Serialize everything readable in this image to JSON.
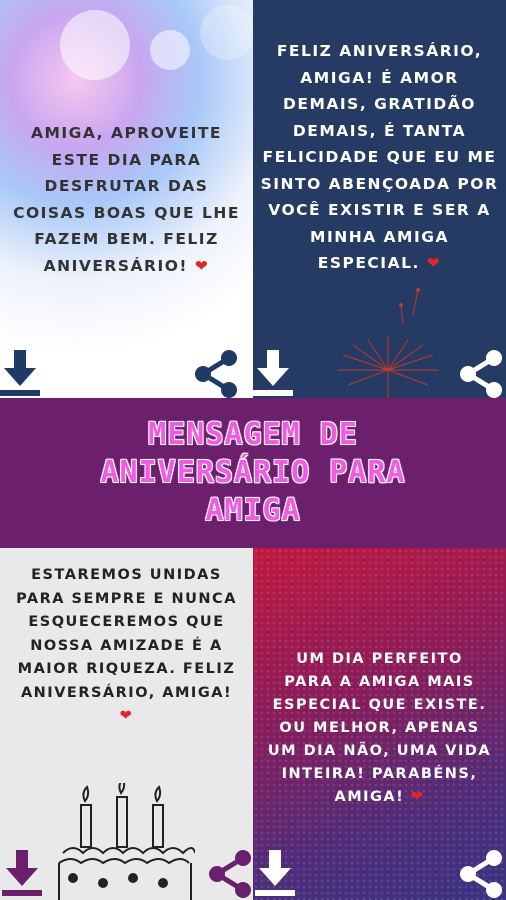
{
  "cards": [
    {
      "lines": [
        "AMIGA, APROVEITE",
        "ESTE DIA PARA",
        "DESFRUTAR DAS",
        "COISAS BOAS QUE LHE",
        "FAZEM BEM. FELIZ"
      ],
      "last_line": "ANIVERSÁRIO!",
      "heart": "❤"
    },
    {
      "lines": [
        "FELIZ ANIVERSÁRIO,",
        "AMIGA! É AMOR",
        "DEMAIS, GRATIDÃO",
        "DEMAIS, É TANTA",
        "FELICIDADE QUE EU ME",
        "SINTO ABENÇOADA POR",
        "VOCÊ EXISTIR E SER A",
        "MINHA AMIGA"
      ],
      "last_line": "ESPECIAL.",
      "heart": "❤"
    },
    {
      "lines": [
        "ESTAREMOS UNIDAS",
        "PARA SEMPRE E NUNCA",
        "ESQUECEREMOS QUE",
        "NOSSA AMIZADE É A",
        "MAIOR RIQUEZA. FELIZ",
        "ANIVERSÁRIO, AMIGA!"
      ],
      "last_line": "",
      "heart": "❤"
    },
    {
      "lines": [
        "UM DIA PERFEITO",
        "PARA A AMIGA MAIS",
        "ESPECIAL QUE EXISTE.",
        "OU MELHOR, APENAS",
        "UM DIA NÃO, UMA VIDA",
        "INTEIRA! PARABÉNS,"
      ],
      "last_line": "AMIGA!",
      "heart": "❤"
    }
  ],
  "title": {
    "lines": [
      "MENSAGEM DE",
      "ANIVERSÁRIO PARA",
      "AMIGA"
    ]
  },
  "colors": {
    "title_band": "#6c1f6c",
    "title_text": "#f05ae4",
    "card2_bg": "#253b63",
    "icon_dark": "#1f3a66",
    "icon_purple": "#6c1f6c"
  },
  "icons": {
    "download": "download-icon",
    "share": "share-icon"
  }
}
